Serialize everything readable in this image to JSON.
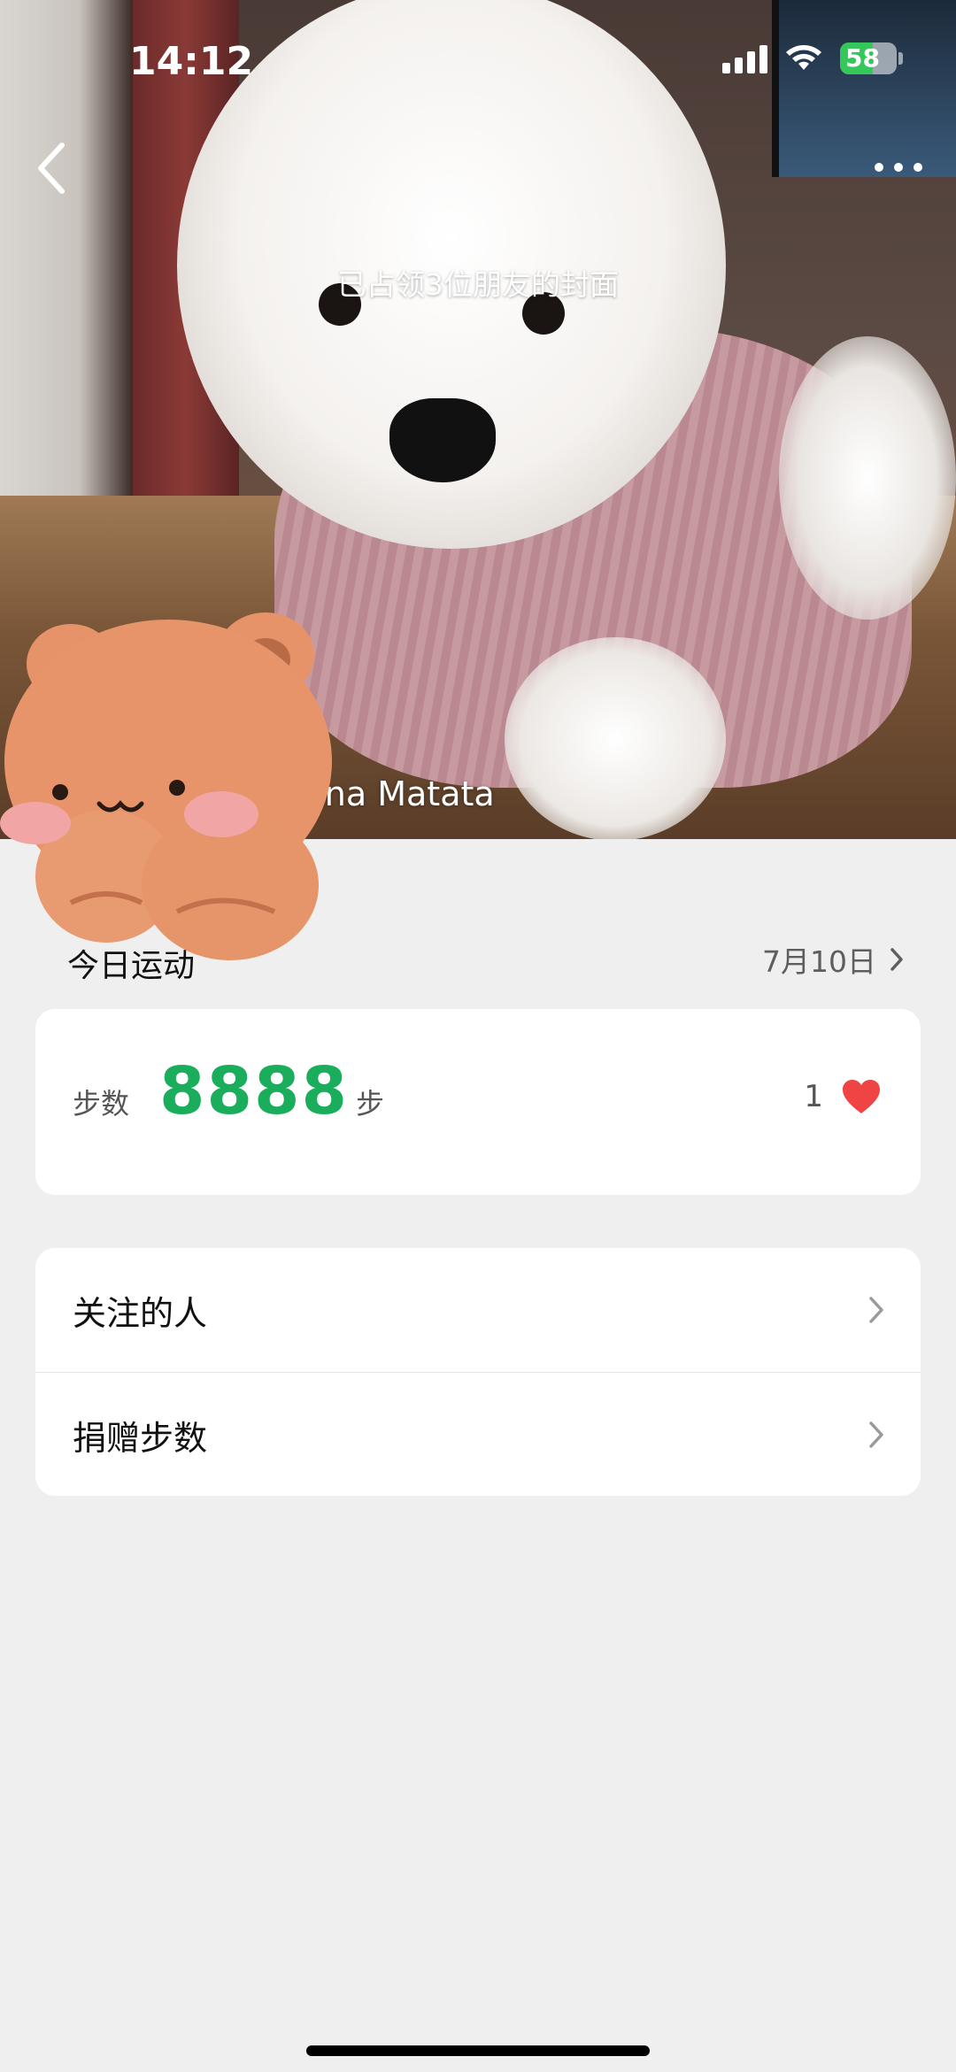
{
  "status_bar": {
    "time": "14:12",
    "battery_level": "58",
    "battery_charging": true,
    "icons": [
      "signal-icon",
      "wifi-icon",
      "battery-icon"
    ]
  },
  "cover": {
    "caption": "已占领3位朋友的封面",
    "user_name": "Hakuna Matata"
  },
  "nav": {
    "back_icon": "chevron-left-icon",
    "more_icon": "more-dots-icon"
  },
  "today": {
    "title": "今日运动",
    "date": "7月10日"
  },
  "steps_card": {
    "label": "步数",
    "value": "8888",
    "unit": "步",
    "likes": "1",
    "like_icon": "heart-icon",
    "accent_color": "#1aad5c",
    "heart_color": "#ef4444"
  },
  "menu": {
    "items": [
      {
        "label": "关注的人"
      },
      {
        "label": "捐赠步数"
      }
    ]
  }
}
